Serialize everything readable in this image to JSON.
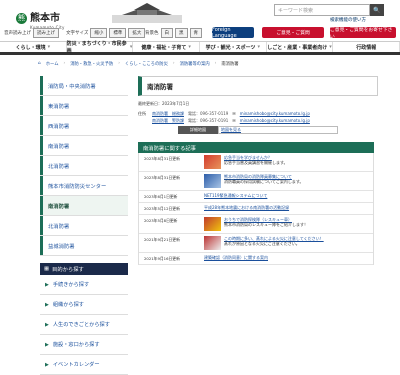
{
  "header": {
    "logo_mark": "熊",
    "logo_text": "熊本市",
    "logo_sub": "Kumamoto City",
    "search_placeholder": "キーワード検索",
    "search_button": "🔍",
    "detail_link": "検索機能の使い方"
  },
  "toolbar": {
    "voice_label": "音声読み上げ",
    "voice_button": "読み上げ",
    "font_label": "文字サイズ",
    "font_buttons": [
      "縮小",
      "標準",
      "拡大"
    ],
    "color_label": "背景色",
    "color_buttons": [
      "白",
      "黒",
      "青"
    ],
    "language_button": "Foreign Language",
    "consult_button": "ご意見・ご質問",
    "contact_button": "ご意見・ご質問をお寄せ下さい"
  },
  "nav": {
    "items": [
      "くらし・環境",
      "防災・まちづくり・市民参画",
      "健康・福祉・子育て",
      "学び・観光・スポーツ",
      "しごと・産業・事業者向け",
      "行政情報"
    ]
  },
  "breadcrumb": {
    "items": [
      "ホーム",
      "消防・救急・火災予防",
      "くらし・こころの防災",
      "消防署等の案内"
    ],
    "current": "南消防署"
  },
  "sidebar": {
    "items": [
      {
        "label": "消防局・中央消防署",
        "active": false
      },
      {
        "label": "東消防署",
        "active": false
      },
      {
        "label": "西消防署",
        "active": false
      },
      {
        "label": "南消防署",
        "active": false
      },
      {
        "label": "北消防署",
        "active": false
      },
      {
        "label": "熊本市消防防災センター",
        "active": false
      },
      {
        "label": "南消防署",
        "active": true
      },
      {
        "label": "北消防署",
        "active": false
      },
      {
        "label": "益城消防署",
        "active": false
      }
    ],
    "purpose_header": "目的から探す",
    "purpose_links": [
      "手続きから探す",
      "組織から探す",
      "人生のできごとから探す",
      "施設・窓口から探す",
      "イベントカレンダー"
    ]
  },
  "main": {
    "title": "南消防署",
    "updated": "最終更新日：2023年7月1日",
    "info": [
      {
        "lbl": "住所",
        "a": "南消防署　総務課",
        "g": "電話：096-357-0119",
        "mail": "minamishobo@city.kumamoto.lg.jp"
      },
      {
        "lbl": "",
        "a": "南消防署　警防課",
        "g": "電話：096-357-0191",
        "mail": "minamishobo@city.kumamoto.lg.jp"
      }
    ],
    "map_label": "詳細地図",
    "map_link": "地図を見る",
    "related_header": "南消防署に関する記事",
    "news": [
      {
        "date": "2023年8月31日更新",
        "title": "応急手当を学びませんか？",
        "desc": "応急手当普及員講習を開催します。",
        "thumb": "a"
      },
      {
        "date": "2023年8月31日更新",
        "title": "熊本市消防局の消防隊員募集について",
        "desc": "消防職員の採用試験についてご案内します。",
        "thumb": "b"
      },
      {
        "date": "2023年6月1日更新",
        "title": "NET119緊急通報システムについて",
        "desc": "",
        "thumb": ""
      },
      {
        "date": "2023年5月12日更新",
        "title": "平成28年熊本地震における南消防署の活動記録",
        "desc": "",
        "thumb": ""
      },
      {
        "date": "2023年5月8日更新",
        "title": "おうちで消防探検隊（レスキュー車）",
        "desc": "熊本市消防局のレスキュー隊をご紹介します！",
        "thumb": "c"
      },
      {
        "date": "2021年9月21日更新",
        "title": "この時期に多い、蒸れによる火災に注意してください！",
        "desc": "蒸れが原因となる火災にご注意ください。",
        "thumb": "d"
      },
      {
        "date": "2021年9月16日更新",
        "title": "建築確認（消防同意）に関する案内",
        "desc": "",
        "thumb": ""
      }
    ]
  }
}
